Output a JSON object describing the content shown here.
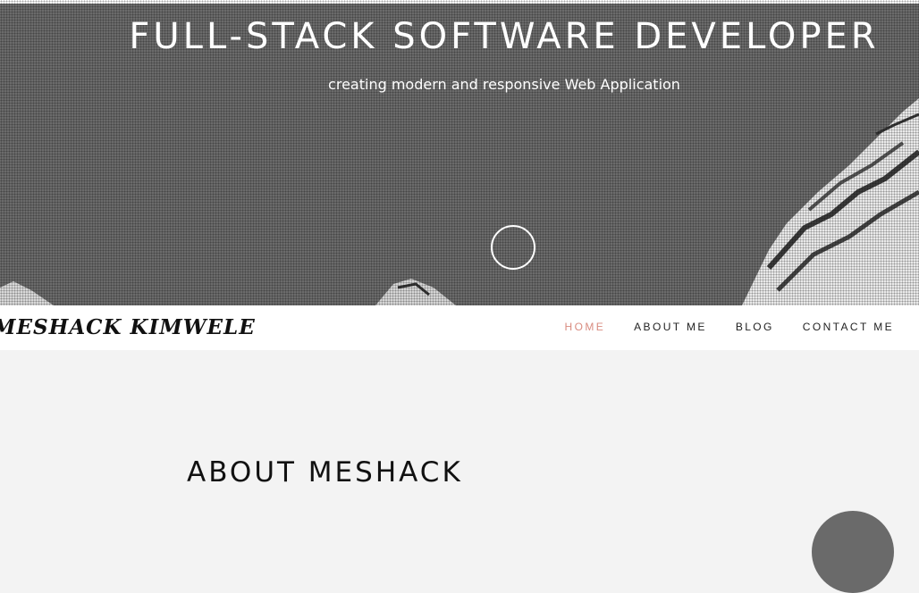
{
  "hero": {
    "title": "FULL-STACK SOFTWARE DEVELOPER",
    "subtitle": "creating modern and responsive Web Application",
    "background_color": "#6b6b6b",
    "scroll_icon": "circle-icon"
  },
  "navbar": {
    "brand": "MESHACK KIMWELE",
    "items": [
      {
        "label": "HOME",
        "active": true
      },
      {
        "label": "ABOUT ME",
        "active": false
      },
      {
        "label": "BLOG",
        "active": false
      },
      {
        "label": "CONTACT ME",
        "active": false
      }
    ],
    "active_color": "#d98c80"
  },
  "about": {
    "heading": "ABOUT MESHACK"
  }
}
